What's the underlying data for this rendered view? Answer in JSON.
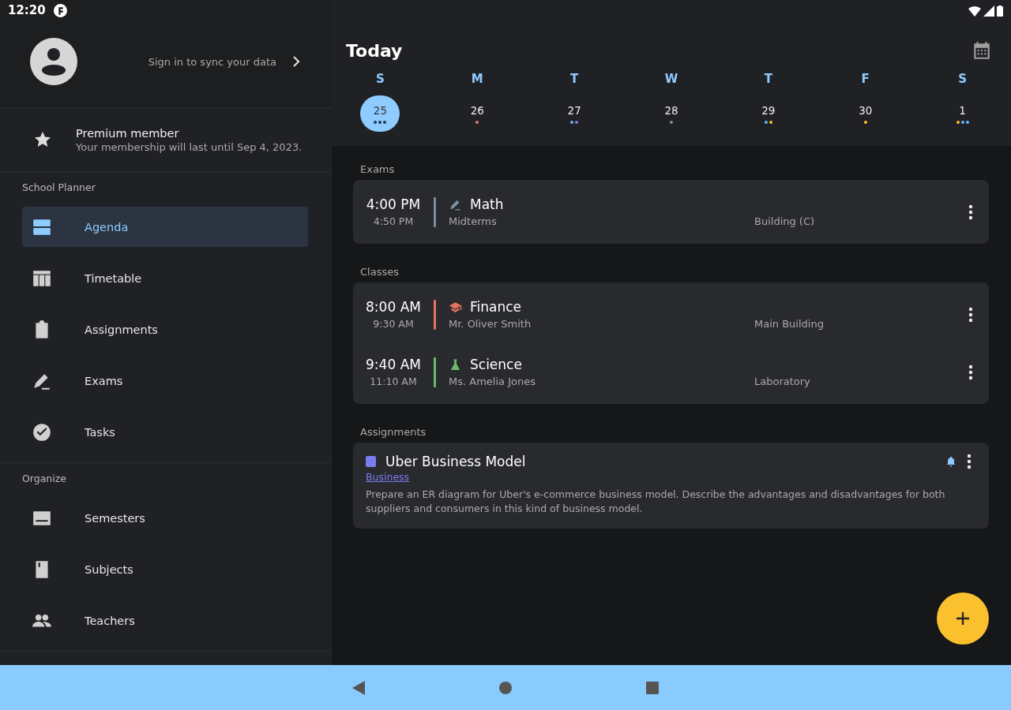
{
  "status_bar": {
    "time": "12:20"
  },
  "drawer": {
    "sign_in": "Sign in to sync your data",
    "premium": {
      "title": "Premium member",
      "subtitle": "Your membership will last until Sep 4, 2023."
    },
    "sections": [
      {
        "title": "School Planner",
        "items": [
          {
            "label": "Agenda",
            "kind": "agenda",
            "selected": true
          },
          {
            "label": "Timetable",
            "kind": "timetable",
            "selected": false
          },
          {
            "label": "Assignments",
            "kind": "assignments",
            "selected": false
          },
          {
            "label": "Exams",
            "kind": "exams",
            "selected": false
          },
          {
            "label": "Tasks",
            "kind": "tasks",
            "selected": false
          }
        ]
      },
      {
        "title": "Organize",
        "items": [
          {
            "label": "Semesters",
            "kind": "semesters",
            "selected": false
          },
          {
            "label": "Subjects",
            "kind": "subjects",
            "selected": false
          },
          {
            "label": "Teachers",
            "kind": "teachers",
            "selected": false
          }
        ]
      }
    ]
  },
  "agenda": {
    "title": "Today",
    "week": [
      {
        "weekday": "S",
        "date": "25",
        "selected": true,
        "dots": [
          {
            "color": "#1f3b57"
          },
          {
            "color": "#1f3b57"
          },
          {
            "color": "#1f3b57"
          }
        ]
      },
      {
        "weekday": "M",
        "date": "26",
        "selected": false,
        "dots": [
          {
            "color": "#e57373"
          }
        ]
      },
      {
        "weekday": "T",
        "date": "27",
        "selected": false,
        "dots": [
          {
            "color": "#64b5f6"
          },
          {
            "color": "#9575cd"
          }
        ]
      },
      {
        "weekday": "W",
        "date": "28",
        "selected": false,
        "dots": [
          {
            "color": "#78909c"
          }
        ]
      },
      {
        "weekday": "T",
        "date": "29",
        "selected": false,
        "dots": [
          {
            "color": "#64b5f6"
          },
          {
            "color": "#fbc02d"
          }
        ]
      },
      {
        "weekday": "F",
        "date": "30",
        "selected": false,
        "dots": [
          {
            "color": "#fbc02d"
          }
        ]
      },
      {
        "weekday": "S",
        "date": "1",
        "selected": false,
        "dots": [
          {
            "color": "#fbc02d"
          },
          {
            "color": "#64b5f6"
          },
          {
            "color": "#64b5f6"
          }
        ]
      }
    ],
    "sections": [
      {
        "title": "Exams",
        "events": [
          {
            "start": "4:00 PM",
            "end": "4:50 PM",
            "kind": "exam",
            "color": "#78909c",
            "title": "Math",
            "detail": "Midterms",
            "location": "Building (C)"
          }
        ]
      },
      {
        "title": "Classes",
        "events": [
          {
            "start": "8:00 AM",
            "end": "9:30 AM",
            "kind": "class",
            "color": "#e57363",
            "title": "Finance",
            "detail": "Mr. Oliver Smith",
            "location": "Main Building"
          },
          {
            "start": "9:40 AM",
            "end": "11:10 AM",
            "kind": "lab",
            "color": "#66bb6a",
            "title": "Science",
            "detail": "Ms. Amelia Jones",
            "location": "Laboratory"
          }
        ]
      }
    ],
    "assignments": {
      "title": "Assignments",
      "items": [
        {
          "title": "Uber Business Model",
          "subject": "Business",
          "color": "#7b7cf0",
          "description": "Prepare an ER diagram for Uber's e-commerce business model. Describe the advantages and disadvantages for both suppliers and consumers in this kind of business model.",
          "reminder": true
        }
      ]
    }
  }
}
